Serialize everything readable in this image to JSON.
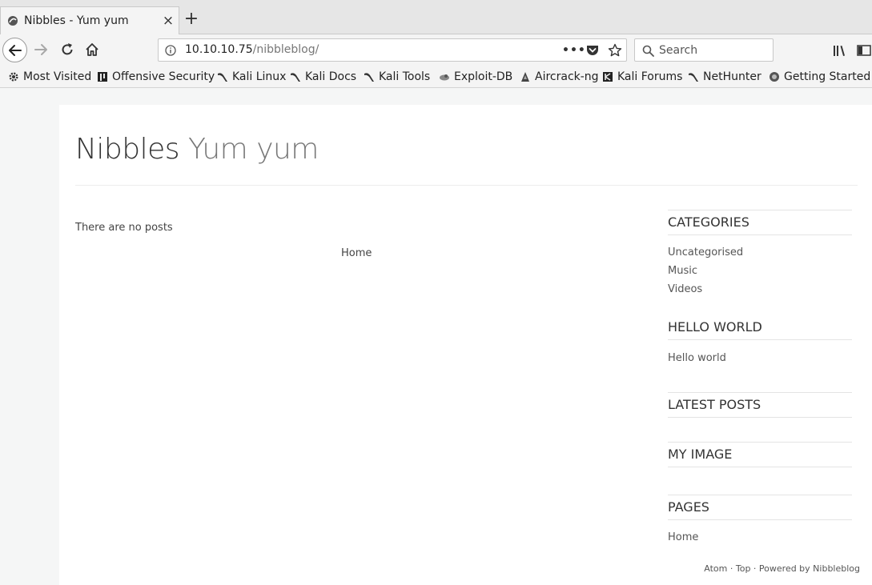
{
  "browser": {
    "tab": {
      "title": "Nibbles - Yum yum",
      "close": "×"
    },
    "new_tab": "+",
    "url": {
      "host": "10.10.10.75",
      "path": "/nibbleblog/",
      "page_actions": "•••"
    },
    "search": {
      "placeholder": "Search"
    },
    "bookmarks": [
      {
        "label": "Most Visited",
        "icon": "gear-icon"
      },
      {
        "label": "Offensive Security",
        "icon": "offsec-icon"
      },
      {
        "label": "Kali Linux",
        "icon": "kali-dragon-icon"
      },
      {
        "label": "Kali Docs",
        "icon": "kali-dragon-icon"
      },
      {
        "label": "Kali Tools",
        "icon": "kali-dragon-icon"
      },
      {
        "label": "Exploit-DB",
        "icon": "exploitdb-icon"
      },
      {
        "label": "Aircrack-ng",
        "icon": "aircrack-icon"
      },
      {
        "label": "Kali Forums",
        "icon": "kali-forums-icon"
      },
      {
        "label": "NetHunter",
        "icon": "kali-dragon-icon"
      },
      {
        "label": "Getting Started",
        "icon": "firefox-icon"
      }
    ]
  },
  "site": {
    "title_main": "Nibbles",
    "title_slogan": "Yum yum",
    "no_posts": "There are no posts",
    "home_link": "Home"
  },
  "sidebar": {
    "categories": {
      "heading": "CATEGORIES",
      "items": [
        "Uncategorised",
        "Music",
        "Videos"
      ]
    },
    "hello_world": {
      "heading": "HELLO WORLD",
      "text": "Hello world"
    },
    "latest_posts": {
      "heading": "LATEST POSTS"
    },
    "my_image": {
      "heading": "MY IMAGE"
    },
    "pages": {
      "heading": "PAGES",
      "items": [
        "Home"
      ]
    }
  },
  "footer": {
    "atom": "Atom",
    "sep1": " · ",
    "top": "Top",
    "sep2": " · ",
    "powered": "Powered by Nibbleblog"
  }
}
